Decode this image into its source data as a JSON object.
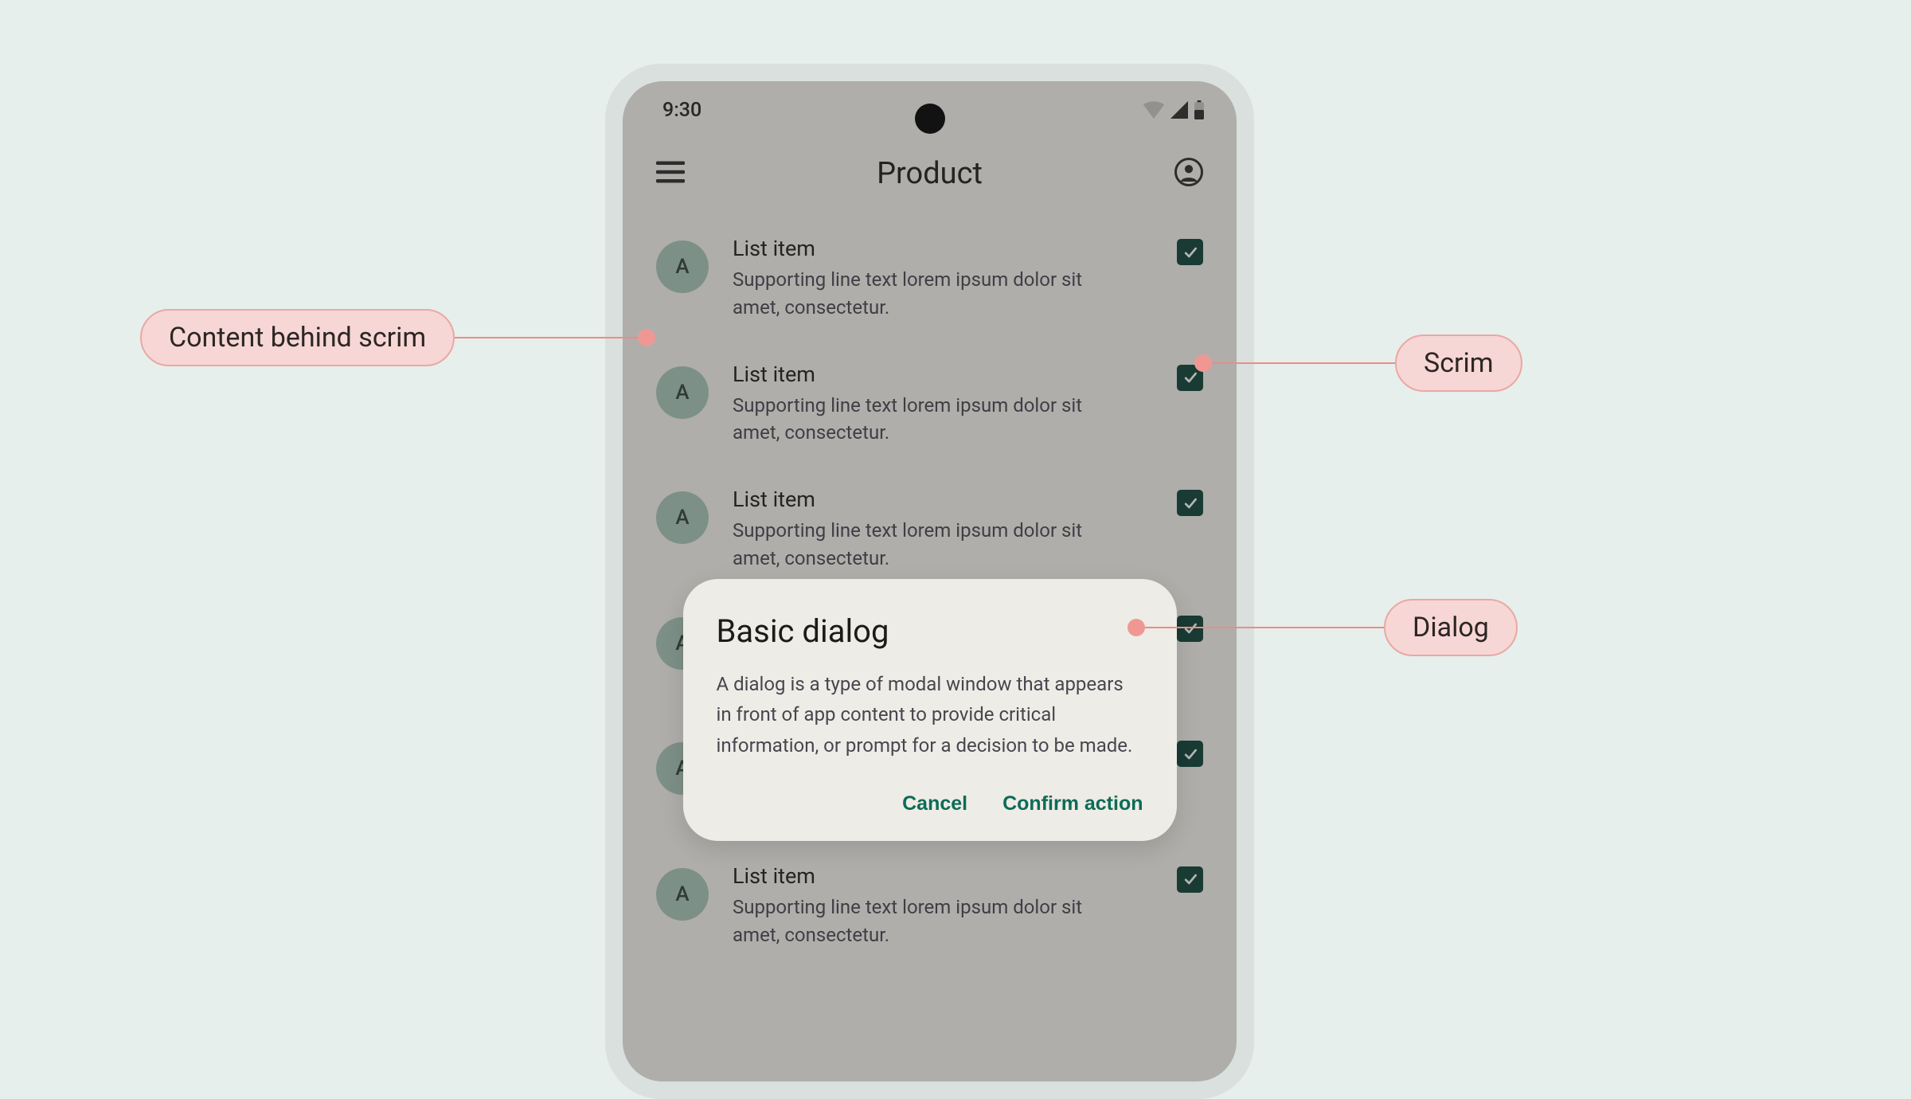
{
  "status": {
    "time": "9:30"
  },
  "appbar": {
    "title": "Product"
  },
  "list": {
    "avatar_letter": "A",
    "item_title": "List item",
    "item_support": "Supporting line text lorem ipsum dolor sit amet, consectetur."
  },
  "dialog": {
    "title": "Basic dialog",
    "body": "A dialog is a type of modal window that appears in front of app content to provide critical information, or prompt for a decision to be made.",
    "cancel": "Cancel",
    "confirm": "Confirm action"
  },
  "annotations": {
    "content_behind_scrim": "Content behind scrim",
    "scrim": "Scrim",
    "dialog": "Dialog"
  },
  "colors": {
    "background": "#e6efec",
    "phone_frame": "#d9e0dd",
    "surface": "#f6f4ef",
    "dialog_surface": "#eeece6",
    "primary": "#0d6b57",
    "checkbox": "#0b4135",
    "annotation_fill": "#f6d7d5",
    "annotation_border": "#eaa8a4",
    "annotation_line": "#ee8b86"
  }
}
